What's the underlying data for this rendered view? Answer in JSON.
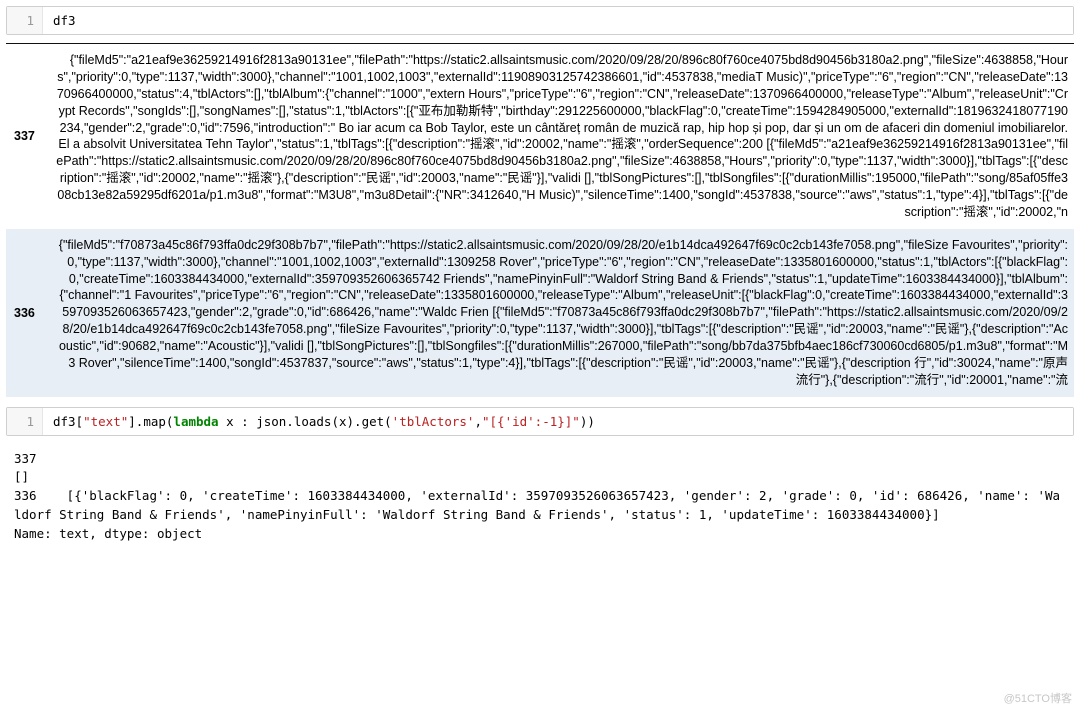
{
  "cell1": {
    "line_no": "1",
    "code": "df3"
  },
  "df_rows": [
    {
      "index": "337",
      "text": "{\"fileMd5\":\"a21eaf9e36259214916f2813a90131ee\",\"filePath\":\"https://static2.allsaintsmusic.com/2020/09/28/20/896c80f760ce4075bd8d90456b3180a2.png\",\"fileSize\":4638858,\"Hours\",\"priority\":0,\"type\":1137,\"width\":3000},\"channel\":\"1001,1002,1003\",\"externalId\":11908903125742386601,\"id\":4537838,\"mediaT Music)\",\"priceType\":\"6\",\"region\":\"CN\",\"releaseDate\":1370966400000,\"status\":4,\"tblActors\":[],\"tblAlbum\":{\"channel\":\"1000\",\"extern Hours\",\"priceType\":\"6\",\"region\":\"CN\",\"releaseDate\":1370966400000,\"releaseType\":\"Album\",\"releaseUnit\":\"Crypt Records\",\"songIds\":[],\"songNames\":[],\"status\":1,\"tblActors\":[{\"亚布加勒斯特\",\"birthday\":291225600000,\"blackFlag\":0,\"createTime\":1594284905000,\"externalId\":1819632418077190234,\"gender\":2,\"grade\":0,\"id\":7596,\"introduction\":\"     Bo iar acum ca Bob Taylor, este un cântăreț român de muzică rap, hip hop și pop, dar și un om de afaceri din domeniul imobiliarelor. El a absolvit Universitatea Tehn Taylor\",\"status\":1,\"tblTags\":[{\"description\":\"摇滚\",\"id\":20002,\"name\":\"摇滚\",\"orderSequence\":200 [{\"fileMd5\":\"a21eaf9e36259214916f2813a90131ee\",\"filePath\":\"https://static2.allsaintsmusic.com/2020/09/28/20/896c80f760ce4075bd8d90456b3180a2.png\",\"fileSize\":4638858,\"Hours\",\"priority\":0,\"type\":1137,\"width\":3000}],\"tblTags\":[{\"description\":\"摇滚\",\"id\":20002,\"name\":\"摇滚\"},{\"description\":\"民谣\",\"id\":20003,\"name\":\"民谣\"}],\"validi [],\"tblSongPictures\":[],\"tblSongfiles\":[{\"durationMillis\":195000,\"filePath\":\"song/85af05ffe308cb13e82a59295df6201a/p1.m3u8\",\"format\":\"M3U8\",\"m3u8Detail\":{\"NR\":3412640,\"H Music)\",\"silenceTime\":1400,\"songId\":4537838,\"source\":\"aws\",\"status\":1,\"type\":4}],\"tblTags\":[{\"description\":\"摇滚\",\"id\":20002,\"n"
    },
    {
      "index": "336",
      "text": "{\"fileMd5\":\"f70873a45c86f793ffa0dc29f308b7b7\",\"filePath\":\"https://static2.allsaintsmusic.com/2020/09/28/20/e1b14dca492647f69c0c2cb143fe7058.png\",\"fileSize Favourites\",\"priority\":0,\"type\":1137,\"width\":3000},\"channel\":\"1001,1002,1003\",\"externalId\":1309258 Rover\",\"priceType\":\"6\",\"region\":\"CN\",\"releaseDate\":1335801600000,\"status\":1,\"tblActors\":[{\"blackFlag\":0,\"createTime\":1603384434000,\"externalId\":359709352606365742 Friends\",\"namePinyinFull\":\"Waldorf String Band & Friends\",\"status\":1,\"updateTime\":1603384434000}],\"tblAlbum\":{\"channel\":\"1 Favourites\",\"priceType\":\"6\",\"region\":\"CN\",\"releaseDate\":1335801600000,\"releaseType\":\"Album\",\"releaseUnit\":[{\"blackFlag\":0,\"createTime\":1603384434000,\"externalId\":3597093526063657423,\"gender\":2,\"grade\":0,\"id\":686426,\"name\":\"Waldc Frien [{\"fileMd5\":\"f70873a45c86f793ffa0dc29f308b7b7\",\"filePath\":\"https://static2.allsaintsmusic.com/2020/09/28/20/e1b14dca492647f69c0c2cb143fe7058.png\",\"fileSize Favourites\",\"priority\":0,\"type\":1137,\"width\":3000}],\"tblTags\":[{\"description\":\"民谣\",\"id\":20003,\"name\":\"民谣\"},{\"description\":\"Acoustic\",\"id\":90682,\"name\":\"Acoustic\"}],\"validi [],\"tblSongPictures\":[],\"tblSongfiles\":[{\"durationMillis\":267000,\"filePath\":\"song/bb7da375bfb4aec186cf730060cd6805/p1.m3u8\",\"format\":\"M3 Rover\",\"silenceTime\":1400,\"songId\":4537837,\"source\":\"aws\",\"status\":1,\"type\":4}],\"tblTags\":[{\"description\":\"民谣\",\"id\":20003,\"name\":\"民谣\"},{\"description 行\",\"id\":30024,\"name\":\"原声流行\"},{\"description\":\"流行\",\"id\":20001,\"name\":\"流"
    }
  ],
  "cell2": {
    "line_no": "1",
    "prefix": "df3[",
    "str1": "\"text\"",
    "mid1": "].map(",
    "kw": "lambda",
    "mid2": " x : json.loads(x).get(",
    "str2": "'tblActors'",
    "mid3": ",",
    "str3": "\"[{'id':-1}]\"",
    "suffix": "))"
  },
  "output2": "337\n[]\n336    [{'blackFlag': 0, 'createTime': 1603384434000, 'externalId': 3597093526063657423, 'gender': 2, 'grade': 0, 'id': 686426, 'name': 'Waldorf String Band & Friends', 'namePinyinFull': 'Waldorf String Band & Friends', 'status': 1, 'updateTime': 1603384434000}]\nName: text, dtype: object",
  "watermark": "@51CTO博客"
}
